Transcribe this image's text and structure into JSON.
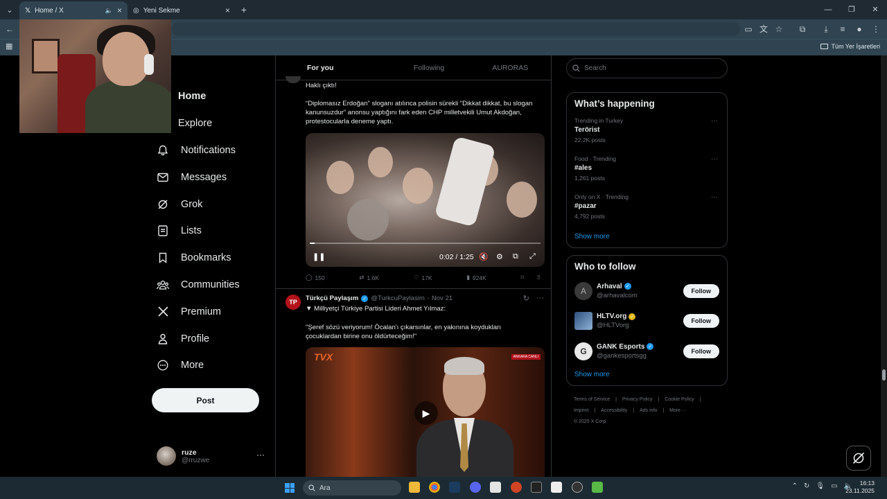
{
  "browser": {
    "tabs": [
      {
        "title": "Home / X",
        "active": true
      },
      {
        "title": "Yeni Sekme",
        "active": false
      }
    ],
    "bookmarks_all": "Tüm Yer İşaretleri"
  },
  "nav": {
    "items": [
      {
        "label": "Home",
        "icon": "home-icon"
      },
      {
        "label": "Explore",
        "icon": "search-icon"
      },
      {
        "label": "Notifications",
        "icon": "bell-icon"
      },
      {
        "label": "Messages",
        "icon": "mail-icon"
      },
      {
        "label": "Grok",
        "icon": "grok-icon"
      },
      {
        "label": "Lists",
        "icon": "list-icon"
      },
      {
        "label": "Bookmarks",
        "icon": "bookmark-icon"
      },
      {
        "label": "Communities",
        "icon": "people-icon"
      },
      {
        "label": "Premium",
        "icon": "x-logo-icon"
      },
      {
        "label": "Profile",
        "icon": "person-icon"
      },
      {
        "label": "More",
        "icon": "more-circle-icon"
      }
    ],
    "post_label": "Post",
    "me": {
      "name": "ruze",
      "handle": "@rruzwe"
    }
  },
  "feed": {
    "tabs": [
      "For you",
      "Following",
      "AURORAS"
    ],
    "tweet1": {
      "text_line1": "Haklı çıktı!",
      "text_body": "“Diplomasız Erdoğan” sloganı atılınca polisin sürekli “Dikkat dikkat, bu slogan kanunsuzdur” anonsu yaptığını fark eden CHP milletvekili Umut Akdoğan, protestocularla deneme yaptı.",
      "video": {
        "time": "0:02 / 1:25",
        "progress": 0.02
      },
      "stats": {
        "replies": "150",
        "reposts": "1.6K",
        "likes": "17K",
        "views": "924K"
      }
    },
    "tweet2": {
      "name": "Türkçü Paylaşım",
      "handle": "@TurkcuPaylasim",
      "date": "· Nov 21",
      "line1": "▼ Milliyetçi Türkiye Partisi Lideri Ahmet Yılmaz:",
      "quote": "\"Şeref sözü veriyorum! Öcalan'ı çıkarsınlar, en yakınına koydukları çocuklardan birine onu öldürteceğim!\"",
      "video_brand": "TVX",
      "video_badge": "ANKARA CANLI"
    }
  },
  "sidebar": {
    "search_placeholder": "Search",
    "happening_title": "What’s happening",
    "trends": [
      {
        "meta": "Trending in Turkey",
        "tag": "Terörist",
        "count": "22.2K posts"
      },
      {
        "meta": "Food · Trending",
        "tag": "#ales",
        "count": "1,261 posts"
      },
      {
        "meta": "Only on X · Trending",
        "tag": "#pazar",
        "count": "4,792 posts"
      }
    ],
    "show_more": "Show more",
    "who_title": "Who to follow",
    "follow": [
      {
        "name": "Arhaval",
        "handle": "@arhavalcom",
        "badge": "blue"
      },
      {
        "name": "HLTV.org",
        "handle": "@HLTVorg",
        "badge": "gold"
      },
      {
        "name": "GANK Esports",
        "handle": "@gankesportsgg",
        "badge": "blue"
      }
    ],
    "follow_label": "Follow",
    "footer": [
      "Terms of Service",
      "Privacy Policy",
      "Cookie Policy",
      "Imprint",
      "Accessibility",
      "Ads info",
      "More ···",
      "© 2025 X Corp."
    ]
  },
  "taskbar": {
    "search": "Ara",
    "time": "16:13",
    "date": "23.11.2025"
  }
}
